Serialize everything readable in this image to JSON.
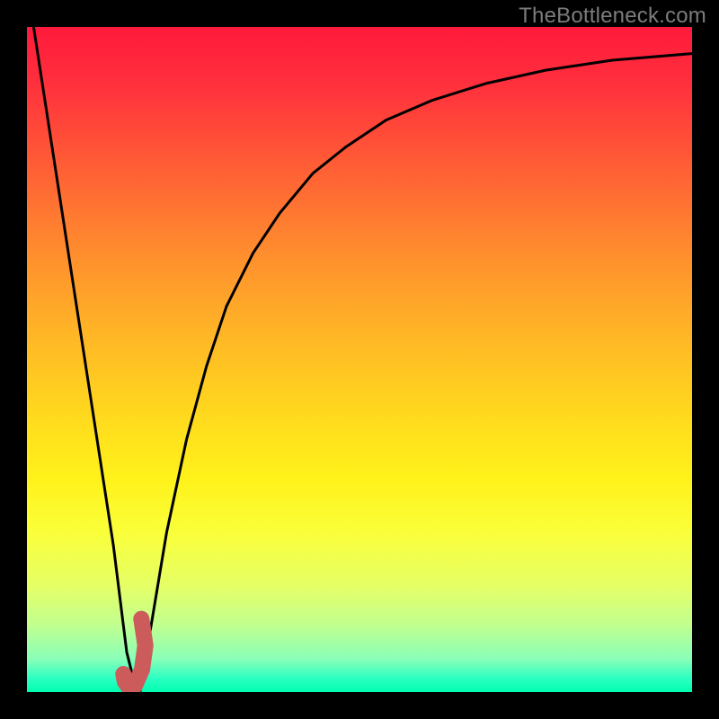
{
  "watermark": "TheBottleneck.com",
  "chart_data": {
    "type": "line",
    "title": "",
    "xlabel": "",
    "ylabel": "",
    "xlim": [
      0,
      100
    ],
    "ylim": [
      0,
      100
    ],
    "grid": false,
    "series": [
      {
        "name": "curve",
        "color": "#000000",
        "x": [
          1,
          3,
          5,
          7,
          9,
          11,
          13,
          14,
          15,
          16,
          17,
          19,
          21,
          24,
          27,
          30,
          34,
          38,
          43,
          48,
          54,
          61,
          69,
          78,
          88,
          100
        ],
        "values": [
          100,
          87,
          74,
          61,
          48,
          35,
          22,
          14,
          6,
          2,
          0,
          12,
          24,
          38,
          49,
          58,
          66,
          72,
          78,
          82,
          86,
          89,
          91.5,
          93.5,
          95,
          96
        ]
      }
    ],
    "marker": {
      "name": "J-marker",
      "color": "#cc5c5c",
      "x": [
        14.5,
        14.7,
        15.2,
        16.2,
        17.3,
        17.8,
        17.2
      ],
      "values": [
        2.7,
        1.6,
        0.9,
        0.9,
        3.4,
        7.0,
        11.0
      ]
    },
    "gradient_stops": [
      {
        "pos": 0,
        "color": "#ff1a3b"
      },
      {
        "pos": 8,
        "color": "#ff2e3d"
      },
      {
        "pos": 20,
        "color": "#ff5a36"
      },
      {
        "pos": 33,
        "color": "#ff8a2e"
      },
      {
        "pos": 46,
        "color": "#ffb526"
      },
      {
        "pos": 58,
        "color": "#ffd81e"
      },
      {
        "pos": 68,
        "color": "#fff21a"
      },
      {
        "pos": 76,
        "color": "#faff3a"
      },
      {
        "pos": 84,
        "color": "#e6ff66"
      },
      {
        "pos": 90,
        "color": "#c0ff90"
      },
      {
        "pos": 95,
        "color": "#8affb8"
      },
      {
        "pos": 98,
        "color": "#2affc2"
      },
      {
        "pos": 100,
        "color": "#00ffb0"
      }
    ]
  }
}
